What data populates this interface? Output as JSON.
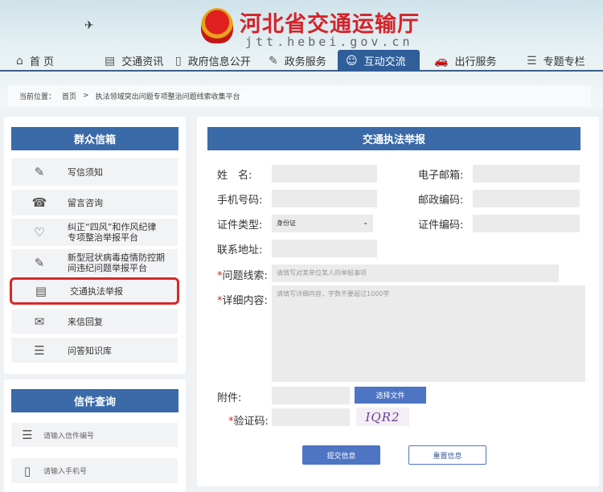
{
  "header": {
    "site_title": "河北省交通运输厅",
    "site_url": "jtt.hebei.gov.cn"
  },
  "nav": [
    {
      "label": "首 页",
      "icon": "home-icon"
    },
    {
      "label": "交通资讯",
      "icon": "document-icon"
    },
    {
      "label": "政府信息公开",
      "icon": "book-icon"
    },
    {
      "label": "政务服务",
      "icon": "edit-icon"
    },
    {
      "label": "互动交流",
      "icon": "chat-icon",
      "active": true
    },
    {
      "label": "出行服务",
      "icon": "car-icon"
    },
    {
      "label": "专题专栏",
      "icon": "list-icon"
    }
  ],
  "breadcrumb": {
    "prefix": "当前位置：",
    "home": "首页",
    "sep": ">",
    "current": "执法领域突出问题专项整治问题线索收集平台"
  },
  "mailbox": {
    "title": "群众信箱",
    "items": [
      {
        "label": "写信须知"
      },
      {
        "label": "留言咨询"
      },
      {
        "label": "纠正“四风”和作风纪律专项整治举报平台"
      },
      {
        "label": "新型冠状病毒疫情防控期间违纪问题举报平台"
      },
      {
        "label": "交通执法举报",
        "selected": true
      },
      {
        "label": "来信回复"
      },
      {
        "label": "问答知识库"
      }
    ]
  },
  "query": {
    "title": "信件查询",
    "letter_placeholder": "请输入信件编号",
    "phone_placeholder": "请输入手机号"
  },
  "form": {
    "title": "交通执法举报",
    "name_label": "姓　名:",
    "email_label": "电子邮箱:",
    "phone_label": "手机号码:",
    "postcode_label": "邮政编码:",
    "id_type_label": "证件类型:",
    "id_type_value": "身份证",
    "id_no_label": "证件编码:",
    "address_label": "联系地址:",
    "clue_label": "问题线索:",
    "clue_placeholder": "请填写对某单位某人的举报事项",
    "detail_label": "详细内容:",
    "detail_placeholder": "请填写详细内容，字数不要超过1000字",
    "attach_label": "附件:",
    "choose_file": "选择文件",
    "captcha_label": "验证码:",
    "captcha_text": "IQR2",
    "required_mark": "*",
    "submit": "提交信息",
    "reset": "重置信息"
  }
}
